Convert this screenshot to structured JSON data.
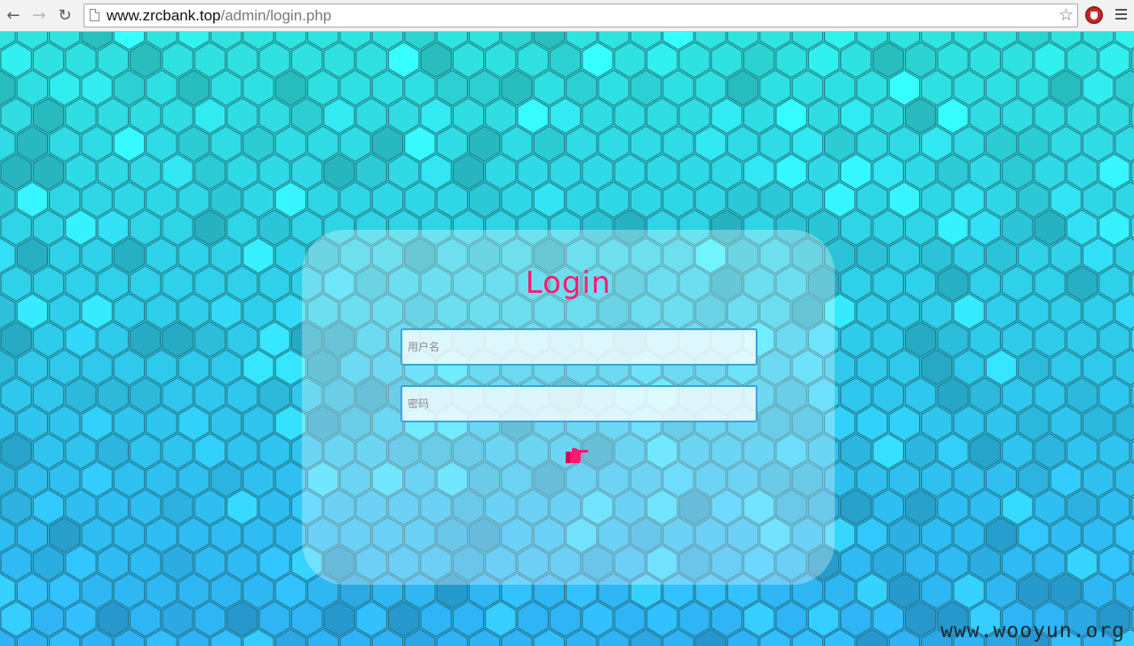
{
  "browser": {
    "url_host": "www.zrcbank.top",
    "url_path": "/admin/login.php",
    "back_icon": "arrow-left-icon",
    "forward_icon": "arrow-right-icon",
    "reload_icon": "reload-icon",
    "bookmark_icon": "star-icon",
    "extension_icon": "adblock-stop-icon",
    "menu_icon": "hamburger-menu-icon"
  },
  "login": {
    "title": "Login",
    "username_placeholder": "用户名",
    "password_placeholder": "密码",
    "submit_icon": "pointing-hand-icon"
  },
  "watermark": "www.wooyun.org",
  "colors": {
    "title": "#ff1a6e",
    "submit_icon": "#ff1a6e",
    "field_border": "#3aa3d8",
    "bg_top": "#2fe4e0",
    "bg_bottom": "#2fb3f6"
  }
}
